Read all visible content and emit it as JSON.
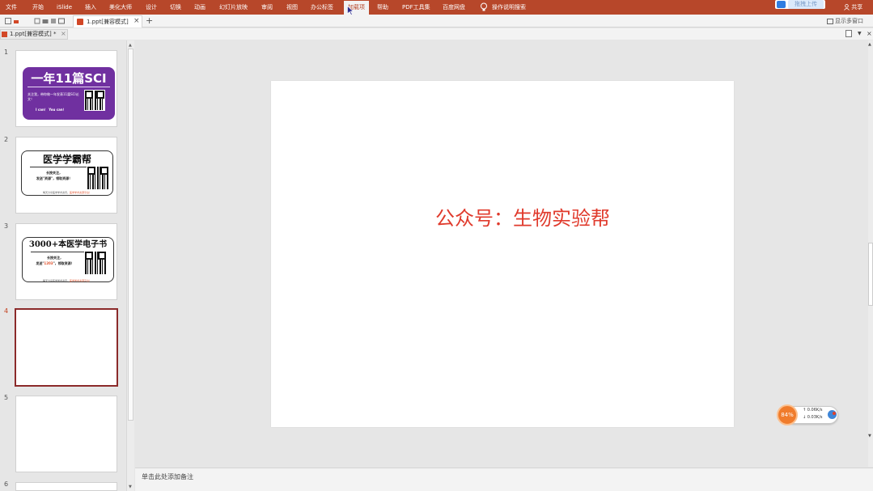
{
  "ribbon": {
    "tabs": [
      "文件",
      "开始",
      "iSlide",
      "插入",
      "美化大师",
      "设计",
      "切换",
      "动画",
      "幻灯片放映",
      "审阅",
      "视图",
      "办公标签",
      "加载项",
      "帮助",
      "PDF工具集",
      "百度网盘",
      "操作说明搜索"
    ],
    "active_tab": "加载项",
    "share": "共享",
    "upload_chip": "拖拽上传"
  },
  "docbar": {
    "tab_name": "1.ppt[兼容模式]",
    "close": "×",
    "new_tab": "+",
    "multi_window": "显示多窗口"
  },
  "filetab": {
    "name": "1.ppt[兼容模式]",
    "modified": "*",
    "close": "×"
  },
  "thumbnails": {
    "numbers": [
      "1",
      "2",
      "3",
      "4",
      "5",
      "6"
    ],
    "active": "4",
    "s1": {
      "title": "一年11篇SCI",
      "desc": "关注我，带你做一年发表11篇SCI论文！",
      "foot": "I can！ You can！"
    },
    "s2": {
      "title": "医学学霸帮",
      "desc1": "长按关注，",
      "desc2": "发送\"资源\"，领取资源！",
      "foot_a": "每天分享医学学术资讯，",
      "foot_b": "医学学术资源平台！"
    },
    "s3": {
      "title": "3000+本医学电子书",
      "desc1": "长按关注，",
      "desc2_a": "发送\"",
      "desc2_b": "1203",
      "desc2_c": "\"，领取资源！",
      "foot_a": "每天分享医学学术资讯，",
      "foot_b": "医学学术资源平台！"
    }
  },
  "slide": {
    "text": "公众号：生物实验帮"
  },
  "notes": {
    "placeholder": "单击此处添加备注"
  },
  "net_widget": {
    "percent": "84%",
    "up": "↑  0.06K/s",
    "down": "↓  0.03K/s"
  },
  "colors": {
    "ribbon": "#b7472a",
    "accent_text": "#e03a2c",
    "purple_card": "#7030a0",
    "net_ball": "#f07c2c"
  }
}
